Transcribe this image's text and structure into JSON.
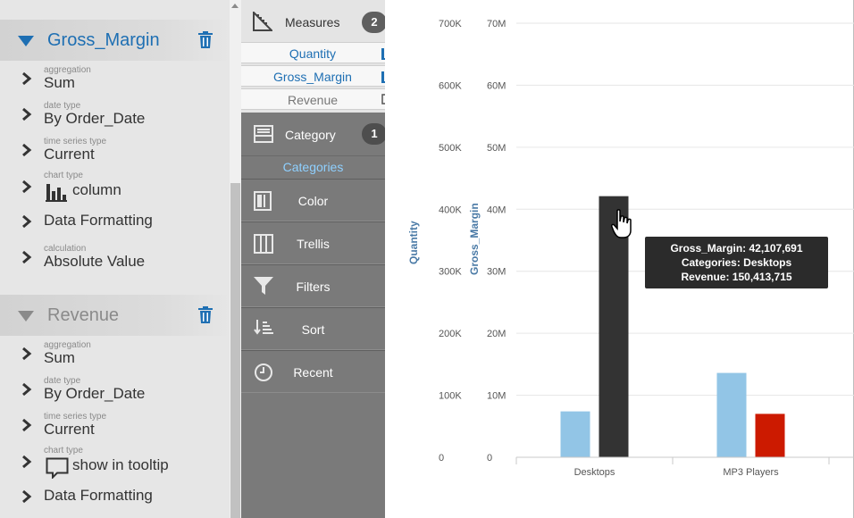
{
  "settings_panel": {
    "measures": [
      {
        "name": "Gross_Margin",
        "active": true,
        "aggregation": {
          "label": "aggregation",
          "value": "Sum"
        },
        "date_type": {
          "label": "date type",
          "value": "By Order_Date"
        },
        "time_series_type": {
          "label": "time series type",
          "value": "Current"
        },
        "chart_type": {
          "label": "chart type",
          "value": "column",
          "icon": "column-chart-icon"
        },
        "data_formatting": {
          "value": "Data Formatting"
        },
        "calculation": {
          "label": "calculation",
          "value": "Absolute Value"
        }
      },
      {
        "name": "Revenue",
        "active": false,
        "aggregation": {
          "label": "aggregation",
          "value": "Sum"
        },
        "date_type": {
          "label": "date type",
          "value": "By Order_Date"
        },
        "time_series_type": {
          "label": "time series type",
          "value": "Current"
        },
        "chart_type": {
          "label": "chart type",
          "value": "show in tooltip",
          "icon": "tooltip-icon"
        },
        "data_formatting": {
          "value": "Data Formatting"
        }
      }
    ]
  },
  "encoding_panel": {
    "measures": {
      "label": "Measures",
      "count": "2",
      "items": [
        {
          "label": "Quantity",
          "icon": "column-chart-icon"
        },
        {
          "label": "Gross_Margin",
          "icon": "column-chart-icon"
        },
        {
          "label": "Revenue",
          "icon": "tooltip-icon"
        }
      ]
    },
    "category": {
      "label": "Category",
      "count": "1",
      "items": [
        "Categories"
      ]
    },
    "shelves": [
      {
        "label": "Color",
        "icon": "color-icon"
      },
      {
        "label": "Trellis",
        "icon": "trellis-icon"
      },
      {
        "label": "Filters",
        "icon": "filter-icon"
      },
      {
        "label": "Sort",
        "icon": "sort-icon"
      },
      {
        "label": "Recent",
        "icon": "clock-icon"
      }
    ]
  },
  "colors": {
    "accent": "#1e6fb3",
    "quantity_bar": "#92c5e6",
    "gross_margin_bar": "#333333",
    "gross_margin_bar_highlight": "#cc1a00",
    "tooltip_bg": "#2b2b2b",
    "categories_text": "#8fd0ff"
  },
  "chart_data": {
    "type": "bar",
    "categories": [
      "Desktops",
      "MP3 Players"
    ],
    "series": [
      {
        "name": "Quantity",
        "axis": "Quantity",
        "values": [
          74000,
          136000
        ],
        "colors": [
          "#92c5e6",
          "#92c5e6"
        ]
      },
      {
        "name": "Gross_Margin",
        "axis": "Gross_Margin",
        "values": [
          42107691,
          7000000
        ],
        "colors": [
          "#333333",
          "#cc1a00"
        ]
      }
    ],
    "axes": [
      {
        "label": "Quantity",
        "ylim": [
          0,
          700000
        ],
        "ticks": [
          "0",
          "100K",
          "200K",
          "300K",
          "400K",
          "500K",
          "600K",
          "700K"
        ]
      },
      {
        "label": "Gross_Margin",
        "ylim": [
          0,
          70000000
        ],
        "ticks": [
          "0",
          "10M",
          "20M",
          "30M",
          "40M",
          "50M",
          "60M",
          "70M"
        ]
      }
    ],
    "grid": true,
    "tooltip": {
      "lines": [
        "Gross_Margin: 42,107,691",
        "Categories: Desktops",
        "Revenue: 150,413,715"
      ]
    }
  }
}
